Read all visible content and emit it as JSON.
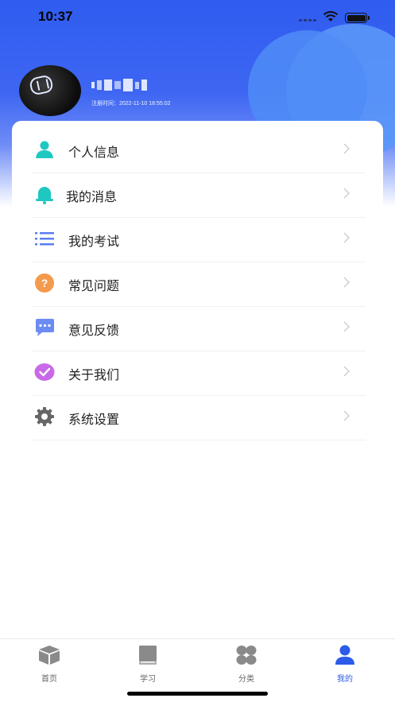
{
  "status_bar": {
    "time": "10:37"
  },
  "profile": {
    "registration_label": "注册时间：2022-11-10 18:55:02"
  },
  "menu": [
    {
      "label": "个人信息",
      "icon": "user-icon",
      "color": "#1ec8c0"
    },
    {
      "label": "我的消息",
      "icon": "bell-icon",
      "color": "#1ec8c0"
    },
    {
      "label": "我的考试",
      "icon": "list-icon",
      "color": "#5a7ef0"
    },
    {
      "label": "常见问题",
      "icon": "question-icon",
      "color": "#f39a4c"
    },
    {
      "label": "意见反馈",
      "icon": "chat-icon",
      "color": "#6b8cf2"
    },
    {
      "label": "关于我们",
      "icon": "check-icon",
      "color": "#c86ae8"
    },
    {
      "label": "系统设置",
      "icon": "gear-icon",
      "color": "#666666"
    }
  ],
  "tabbar": [
    {
      "label": "首页",
      "icon": "box-icon",
      "active": false
    },
    {
      "label": "学习",
      "icon": "book-icon",
      "active": false
    },
    {
      "label": "分类",
      "icon": "grid-icon",
      "active": false
    },
    {
      "label": "我的",
      "icon": "person-icon",
      "active": true
    }
  ],
  "colors": {
    "accent": "#2b5be8",
    "header": "#2f5cf0"
  }
}
